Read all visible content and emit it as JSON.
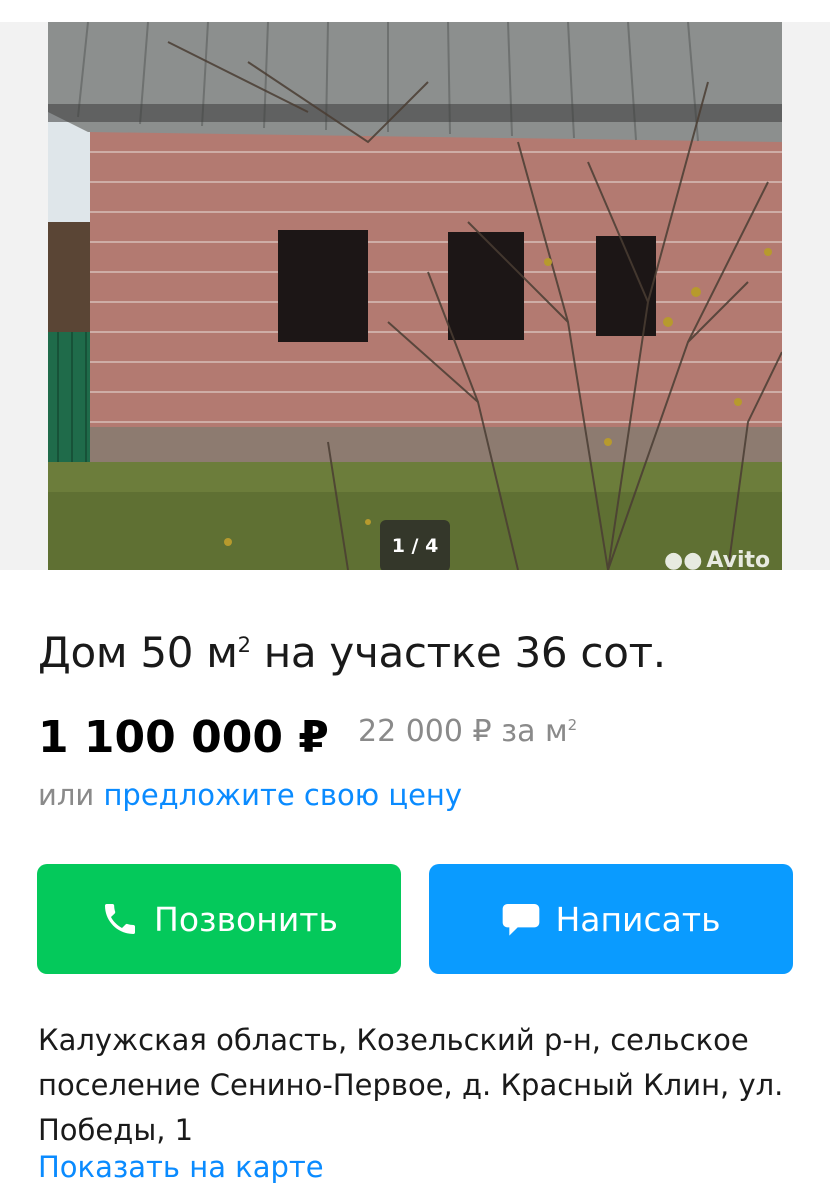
{
  "gallery": {
    "counter": "1 / 4",
    "watermark": "Avito"
  },
  "listing": {
    "title_main": "Дом 50 м",
    "title_sup": "2",
    "title_rest": " на участке 36 сот.",
    "price": "1 100 000 ₽",
    "price_per_m": "22 000 ₽ за м",
    "price_per_m_sup": "2",
    "offer_prefix": "или ",
    "offer_link": "предложите свою цену"
  },
  "actions": {
    "call_label": "Позвонить",
    "write_label": "Написать"
  },
  "location": {
    "address": "Калужская область, Козельский р-н, сельское поселение Сенино-Первое, д. Красный Клин, ул. Победы, 1",
    "map_link": "Показать на карте"
  },
  "colors": {
    "call_button": "#04c95b",
    "write_button": "#0a9bff",
    "link": "#0a8bff",
    "muted_text": "#8a8a8a"
  },
  "icons": {
    "call": "phone-icon",
    "write": "chat-bubble-icon"
  }
}
